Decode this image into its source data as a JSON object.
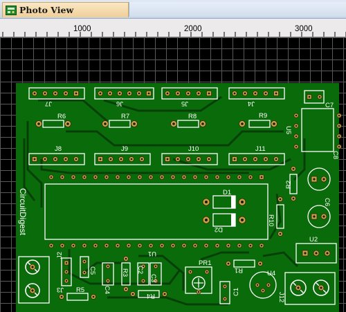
{
  "window": {
    "tab_title": "Photo View",
    "tab_icon": "pcb-view-icon"
  },
  "ruler": {
    "labels": [
      "1000",
      "2000",
      "3000"
    ]
  },
  "colors": {
    "board": "#0a6b0a",
    "trace": "#083f08",
    "silkscreen": "#ffffff",
    "pad": "#c8a048",
    "grid_dot": "#7a7a7a",
    "background": "#000000"
  },
  "board": {
    "brand": "CircuitDigest",
    "headers": [
      {
        "ref": "J7",
        "pins": 5
      },
      {
        "ref": "J6",
        "pins": 6
      },
      {
        "ref": "J5",
        "pins": 5
      },
      {
        "ref": "J4",
        "pins": 5
      },
      {
        "ref": "J8",
        "pins": 5
      },
      {
        "ref": "J9",
        "pins": 5
      },
      {
        "ref": "J10",
        "pins": 5
      },
      {
        "ref": "J11",
        "pins": 5
      }
    ],
    "resistors": [
      "R6",
      "R7",
      "R8",
      "R9",
      "R2",
      "R10",
      "R1",
      "R5",
      "R3",
      "R4"
    ],
    "capacitors": [
      "C7",
      "C8",
      "C6",
      "C5",
      "C4",
      "C2",
      "C3",
      "C1"
    ],
    "diodes": [
      "D1",
      "D2"
    ],
    "ics": [
      "U1",
      "U5",
      "U2",
      "U4"
    ],
    "connectors": [
      "J2",
      "J3",
      "J12"
    ],
    "potentiometer": "PR1"
  }
}
